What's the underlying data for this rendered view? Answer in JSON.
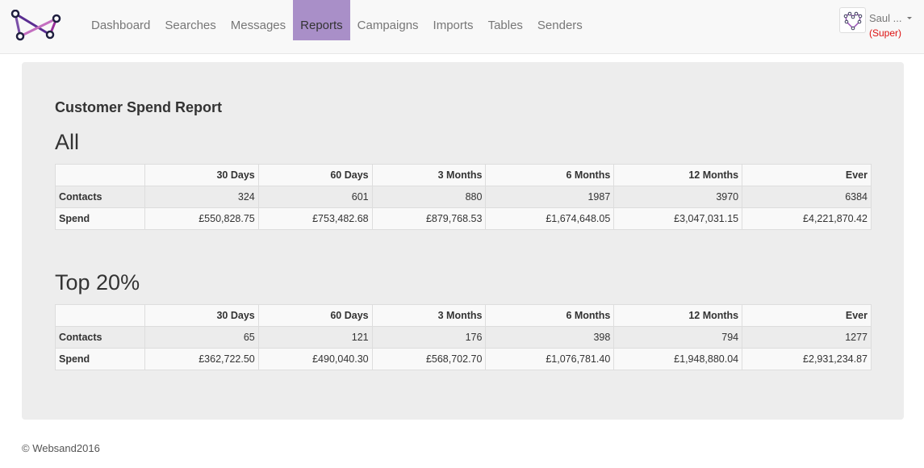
{
  "nav": {
    "items": [
      {
        "label": "Dashboard",
        "active": false
      },
      {
        "label": "Searches",
        "active": false
      },
      {
        "label": "Messages",
        "active": false
      },
      {
        "label": "Reports",
        "active": true
      },
      {
        "label": "Campaigns",
        "active": false
      },
      {
        "label": "Imports",
        "active": false
      },
      {
        "label": "Tables",
        "active": false
      },
      {
        "label": "Senders",
        "active": false
      }
    ],
    "active_color": "#a98fc8"
  },
  "user": {
    "name": "Saul ...",
    "role": "(Super)",
    "role_color": "#dd1111"
  },
  "report": {
    "title": "Customer Spend Report",
    "columns": [
      "",
      "30 Days",
      "60 Days",
      "3 Months",
      "6 Months",
      "12 Months",
      "Ever"
    ],
    "sections": [
      {
        "title": "All",
        "rows": [
          {
            "label": "Contacts",
            "values": [
              "324",
              "601",
              "880",
              "1987",
              "3970",
              "6384"
            ]
          },
          {
            "label": "Spend",
            "values": [
              "£550,828.75",
              "£753,482.68",
              "£879,768.53",
              "£1,674,648.05",
              "£3,047,031.15",
              "£4,221,870.42"
            ]
          }
        ]
      },
      {
        "title": "Top 20%",
        "rows": [
          {
            "label": "Contacts",
            "values": [
              "65",
              "121",
              "176",
              "398",
              "794",
              "1277"
            ]
          },
          {
            "label": "Spend",
            "values": [
              "£362,722.50",
              "£490,040.30",
              "£568,702.70",
              "£1,076,781.40",
              "£1,948,880.04",
              "£2,931,234.87"
            ]
          }
        ]
      }
    ]
  },
  "footer": {
    "text": "© Websand2016"
  }
}
